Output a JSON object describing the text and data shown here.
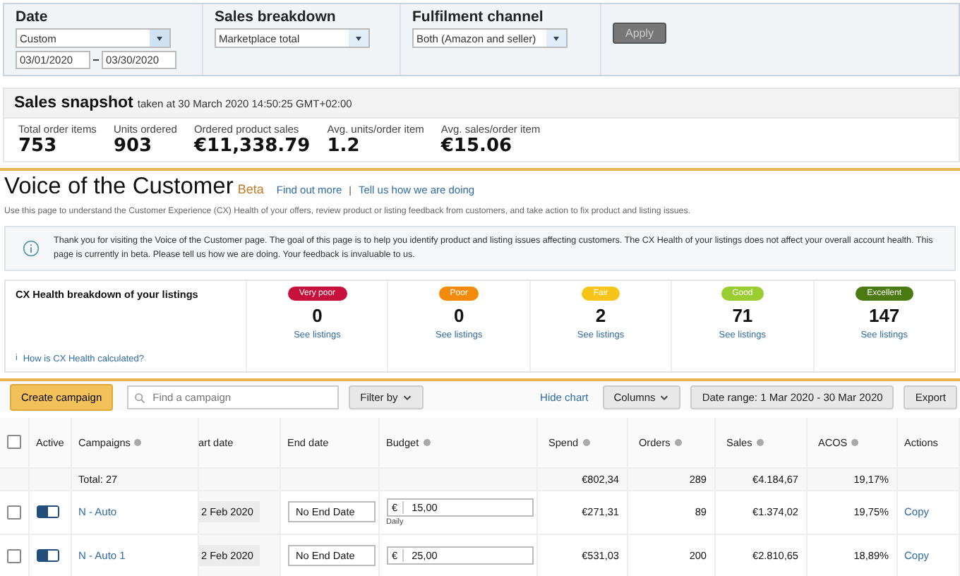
{
  "filters": {
    "date": {
      "label": "Date",
      "select": "Custom",
      "from": "03/01/2020",
      "to": "03/30/2020"
    },
    "sales_breakdown": {
      "label": "Sales breakdown",
      "select": "Marketplace total"
    },
    "fulfilment_channel": {
      "label": "Fulfilment channel",
      "select": "Both (Amazon and seller)"
    },
    "apply_button": {
      "label": "Apply",
      "disabled": true
    }
  },
  "sales_snapshot": {
    "title": "Sales snapshot",
    "subtitle": "taken at 30 March 2020 14:50:25 GMT+02:00",
    "metrics": [
      {
        "label": "Total order items",
        "value": "753"
      },
      {
        "label": "Units ordered",
        "value": "903"
      },
      {
        "label": "Ordered product sales",
        "value": "€11,338.79"
      },
      {
        "label": "Avg. units/order item",
        "value": "1.2"
      },
      {
        "label": "Avg. sales/order item",
        "value": "€15.06"
      }
    ]
  },
  "voice_of_customer": {
    "title": "Voice of the Customer",
    "badge": "Beta",
    "links": [
      "Find out more",
      "Tell us how we are doing"
    ],
    "separator": "|",
    "description": "Use this page to understand the Customer Experience (CX) Health of your offers, review product or listing feedback from customers, and take action to fix product and listing issues.",
    "notice": "Thank you for visiting the Voice of the Customer page. The goal of this page is to help you identify product and listing issues affecting customers. The CX Health of your listings does not affect your overall account health. This page is currently in beta. Please tell us how we are doing. Your feedback is invaluable to us."
  },
  "cx_health": {
    "title": "CX Health breakdown of your listings",
    "link_icon": "i",
    "link": "How is CX Health calculated?",
    "levels": [
      {
        "label": "Very poor",
        "color": "#c7103c",
        "count": "0",
        "link": "See listings"
      },
      {
        "label": "Poor",
        "color": "#f28b0c",
        "count": "0",
        "link": "See listings"
      },
      {
        "label": "Fair",
        "color": "#f7c51a",
        "count": "2",
        "link": "See listings"
      },
      {
        "label": "Good",
        "color": "#9acd32",
        "count": "71",
        "link": "See listings"
      },
      {
        "label": "Excellent",
        "color": "#4b7a12",
        "count": "147",
        "link": "See listings"
      }
    ]
  },
  "campaigns": {
    "create_button": "Create campaign",
    "search": {
      "placeholder": "Find a campaign"
    },
    "filter_button": "Filter by",
    "hide_chart": "Hide chart",
    "columns_button": "Columns",
    "date_range_button": "Date range: 1 Mar 2020 - 30 Mar 2020",
    "export_button": "Export",
    "table": {
      "select_all_checked": false,
      "columns": [
        {
          "label": "Active",
          "info": false
        },
        {
          "label": "Campaigns",
          "info": true
        },
        {
          "label": "art date",
          "info": false
        },
        {
          "label": "End date",
          "info": false
        },
        {
          "label": "Budget",
          "info": true
        },
        {
          "label": "Spend",
          "info": true
        },
        {
          "label": "Orders",
          "info": true
        },
        {
          "label": "Sales",
          "info": true
        },
        {
          "label": "ACOS",
          "info": true
        },
        {
          "label": "Actions",
          "info": false
        }
      ],
      "total": {
        "label": "Total: 27",
        "spend": "€802,34",
        "orders": "289",
        "sales": "€4.184,67",
        "acos": "19,17%"
      },
      "rows": [
        {
          "checked": false,
          "active": true,
          "name": "N - Auto",
          "start_date": "2 Feb 2020",
          "end_date": "No End Date",
          "currency": "€",
          "budget": "15,00",
          "budget_period": "Daily",
          "spend": "€271,31",
          "orders": "89",
          "sales": "€1.374,02",
          "acos": "19,75%",
          "action": "Copy"
        },
        {
          "checked": false,
          "active": true,
          "name": "N - Auto 1",
          "start_date": "2 Feb 2020",
          "end_date": "No End Date",
          "currency": "€",
          "budget": "25,00",
          "spend": "€531,03",
          "orders": "200",
          "sales": "€2.810,65",
          "acos": "18,89%",
          "action": "Copy"
        }
      ]
    }
  }
}
